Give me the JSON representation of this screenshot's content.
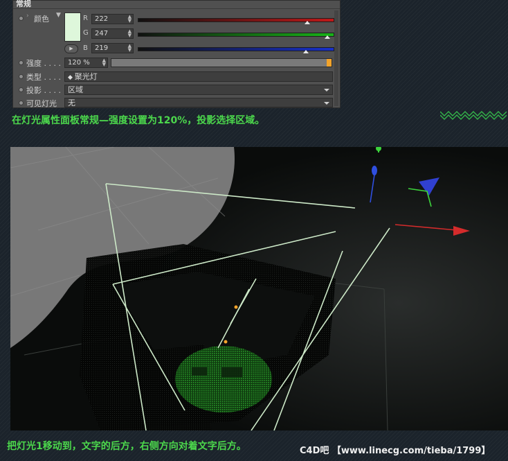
{
  "panel": {
    "section_title": "常规",
    "color": {
      "label": "颜色",
      "swatch_hex": "#def7db",
      "channels": [
        {
          "name": "R",
          "value": "222",
          "fraction": 0.87,
          "bar_color": "#c01818"
        },
        {
          "name": "G",
          "value": "247",
          "fraction": 0.97,
          "bar_color": "#18b418"
        },
        {
          "name": "B",
          "value": "219",
          "fraction": 0.86,
          "bar_color": "#1830c8"
        }
      ]
    },
    "intensity": {
      "label": "强度 . . . .",
      "value": "120 %",
      "fraction": 1.0
    },
    "type": {
      "label": "类型 . . . .",
      "value": "聚光灯",
      "icon": "spotlight-icon"
    },
    "shadow": {
      "label": "投影 . . . .",
      "value": "区域"
    },
    "visible_light": {
      "label": "可见灯光",
      "value": "无"
    }
  },
  "captions": {
    "top": "在灯光属性面板常规—强度设置为120%，投影选择区域。",
    "bottom": "把灯光1移动到，文字的后方，右侧方向对着文字后方。"
  },
  "watermark": "C4D吧 【www.linecg.com/tieba/1799】",
  "colors": {
    "caption_green": "#4cd84c",
    "accent_orange": "#f2a32b"
  }
}
